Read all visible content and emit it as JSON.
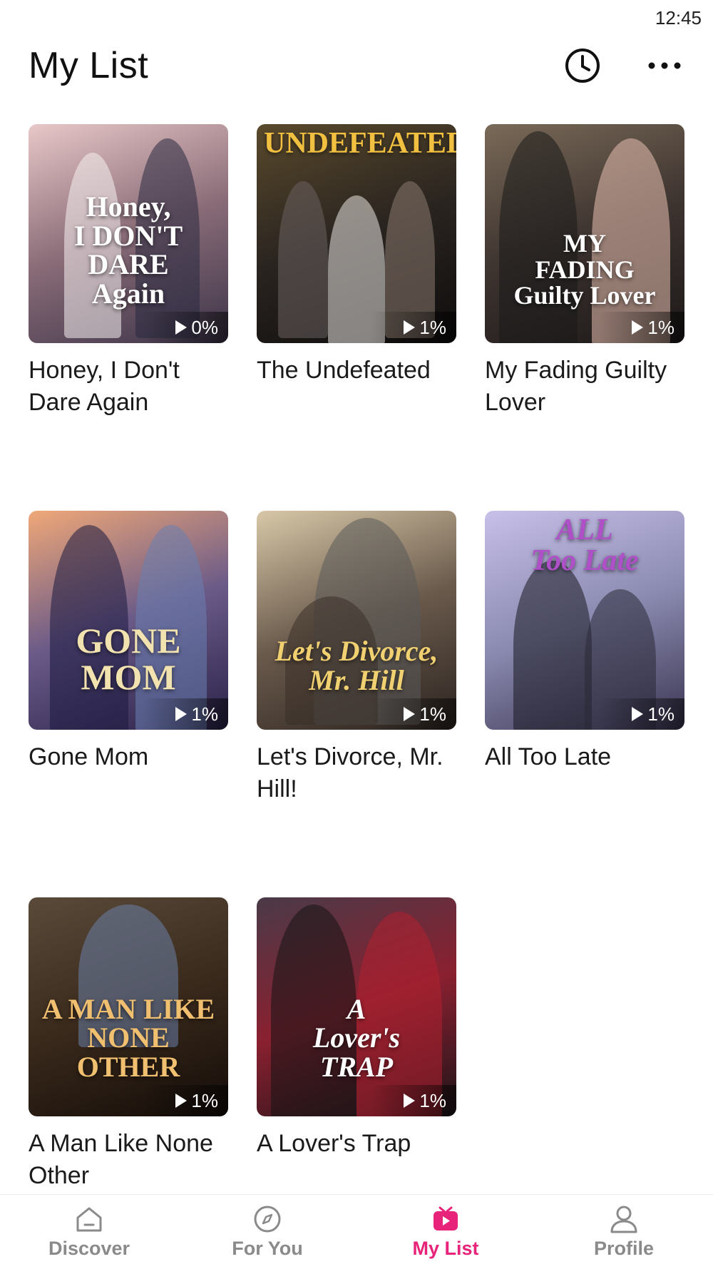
{
  "status": {
    "time": "12:45"
  },
  "header": {
    "title": "My List",
    "history_icon": "clock-icon",
    "more_icon": "more-horizontal-icon"
  },
  "items": [
    {
      "title": "Honey, I Don't Dare Again",
      "cover_text": "Honey,\nI DON'T DARE\nAgain",
      "progress": "0%",
      "colors": [
        "#e8c8c8",
        "#8a6c78",
        "#3c3448"
      ]
    },
    {
      "title": "The Undefeated",
      "cover_text": "UNDEFEATED",
      "progress": "1%",
      "colors": [
        "#5a4a2c",
        "#2a2420",
        "#0e0c0c"
      ]
    },
    {
      "title": "My Fading Guilty Lover",
      "cover_text": "MY\nFADING\nGuilty Lover",
      "progress": "1%",
      "colors": [
        "#7a6a58",
        "#3e3430",
        "#1c1818"
      ]
    },
    {
      "title": "Gone Mom",
      "cover_text": "GONE\nMOM",
      "progress": "1%",
      "colors": [
        "#f0a878",
        "#6a5a88",
        "#2a2248"
      ]
    },
    {
      "title": "Let's Divorce, Mr. Hill!",
      "cover_text": "Let's Divorce,\nMr. Hill",
      "progress": "1%",
      "colors": [
        "#d8c8a8",
        "#6a5a4c",
        "#2c2420"
      ]
    },
    {
      "title": "All Too Late",
      "cover_text": "ALL\nToo Late",
      "progress": "1%",
      "colors": [
        "#c8c0e8",
        "#8a8ab0",
        "#3a3450"
      ]
    },
    {
      "title": "A Man Like None Other",
      "cover_text": "A MAN LIKE\nNONE\nOTHER",
      "progress": "1%",
      "colors": [
        "#5a4a3a",
        "#3a2a1c",
        "#140c08"
      ]
    },
    {
      "title": "A Lover's Trap",
      "cover_text": "A\nLover's\nTRAP",
      "progress": "1%",
      "colors": [
        "#4a3a48",
        "#8a2030",
        "#1c1418"
      ]
    }
  ],
  "tabbar": {
    "tabs": [
      {
        "label": "Discover",
        "icon": "home-icon",
        "active": false
      },
      {
        "label": "For You",
        "icon": "compass-icon",
        "active": false
      },
      {
        "label": "My List",
        "icon": "play-icon",
        "active": true
      },
      {
        "label": "Profile",
        "icon": "user-icon",
        "active": false
      }
    ],
    "active_color": "#e8247a",
    "inactive_color": "#8a8a8a"
  }
}
